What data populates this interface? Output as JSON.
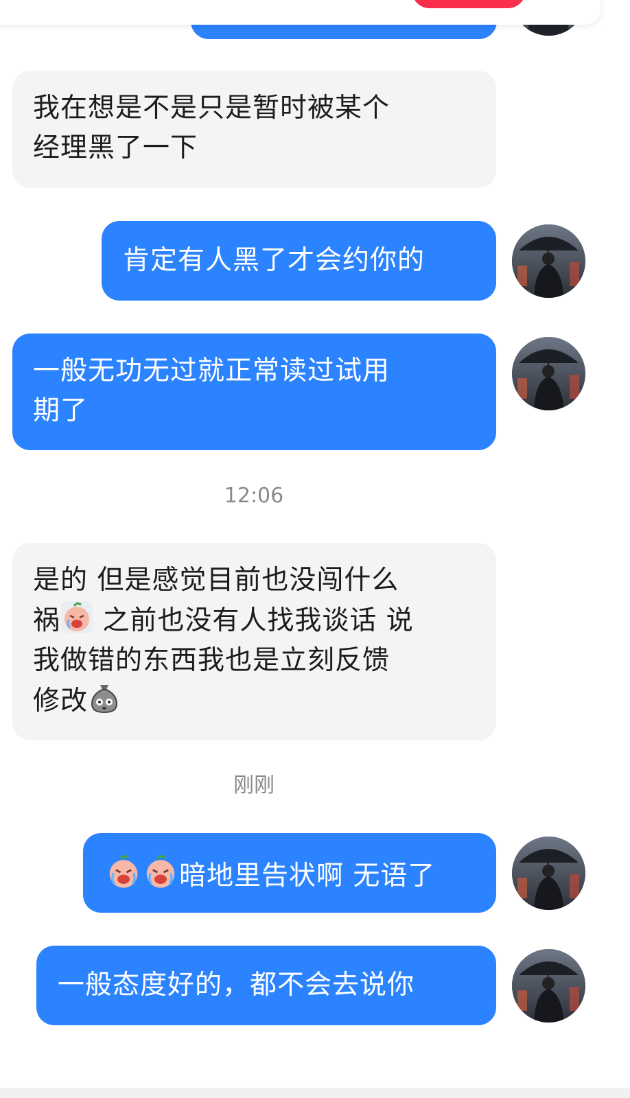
{
  "messages": [
    {
      "id": "m0",
      "side": "outgoing",
      "text": "",
      "partial": true
    },
    {
      "id": "m1",
      "side": "incoming",
      "lines": [
        "我在想是不是只是暂时被某个",
        "经理黑了一下"
      ]
    },
    {
      "id": "m2",
      "side": "outgoing",
      "text": "肯定有人黑了才会约你的"
    },
    {
      "id": "m3",
      "side": "outgoing",
      "lines": [
        "一般无功无过就正常读过试用",
        "期了"
      ]
    },
    {
      "id": "m4",
      "side": "incoming",
      "parts": {
        "line1": "是的 但是感觉目前也没闯什么",
        "line2a": "祸",
        "line2b": " 之前也没有人找我谈话 说",
        "line3": "我做错的东西我也是立刻反馈",
        "line4": "修改"
      }
    },
    {
      "id": "m5",
      "side": "outgoing",
      "text": "暗地里告状啊 无语了"
    },
    {
      "id": "m6",
      "side": "outgoing",
      "text": "一般态度好的，都不会去说你"
    }
  ],
  "timestamps": {
    "t1": "12:06",
    "t2": "刚刚"
  },
  "icons": {
    "crying_face": "crying-face-emoji",
    "sack_face": "sack-face-emoji",
    "avatar": "umbrella-man-avatar"
  },
  "colors": {
    "outgoing_bubble": "#2c83ff",
    "incoming_bubble": "#f4f4f5",
    "top_button": "#fa2d4d"
  }
}
